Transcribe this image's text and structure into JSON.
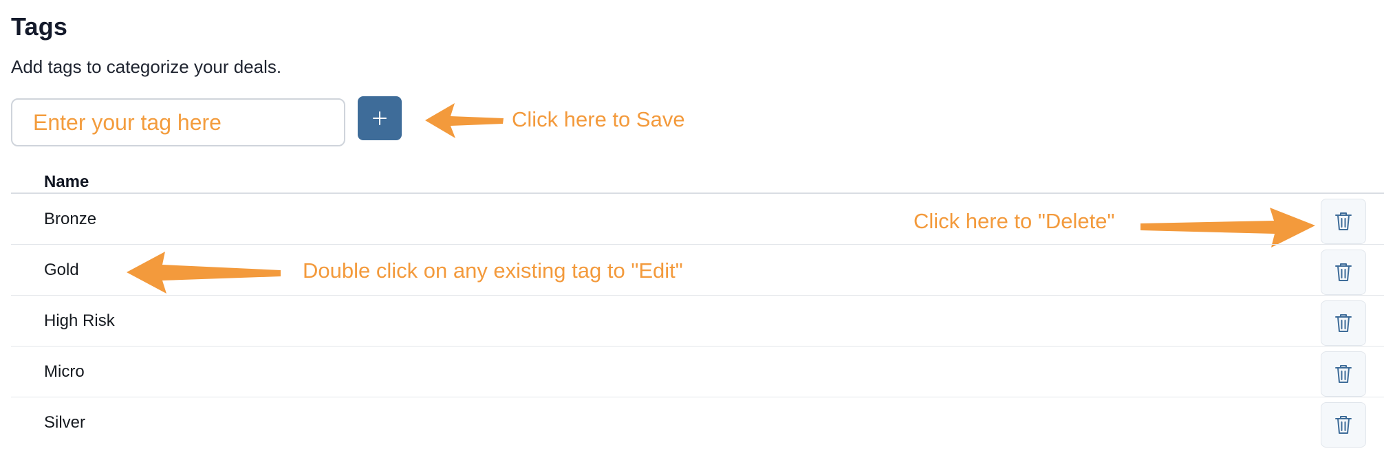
{
  "header": {
    "title": "Tags",
    "subtitle": "Add tags to categorize your deals."
  },
  "form": {
    "placeholder": "Enter your tag here",
    "add_icon": "plus-icon"
  },
  "annotations": {
    "save_hint": "Click here to Save",
    "delete_hint": "Click here to \"Delete\"",
    "edit_hint": "Double click on any existing tag to \"Edit\""
  },
  "table": {
    "header": "Name",
    "rows": [
      {
        "name": "Bronze"
      },
      {
        "name": "Gold"
      },
      {
        "name": "High Risk"
      },
      {
        "name": "Micro"
      },
      {
        "name": "Silver"
      }
    ],
    "delete_icon": "trash-icon"
  },
  "colors": {
    "annotation": "#f39a3c",
    "primary": "#3e6c99",
    "delete_icon": "#3e6c99"
  }
}
